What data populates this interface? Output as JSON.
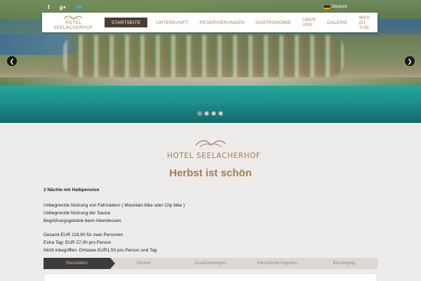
{
  "social": [
    "f",
    "g+",
    "🐦"
  ],
  "language": "Deutsch",
  "brand": {
    "line1": "HOTEL",
    "line2": "SEELACHERHOF",
    "full": "HOTEL SEELACHERHOF"
  },
  "nav": {
    "items": [
      {
        "label": "STARTSEITE",
        "active": true
      },
      {
        "label": "UNTERKUNFT",
        "active": false
      },
      {
        "label": "RESERVIERUNGEN",
        "active": false
      },
      {
        "label": "GASTRONOMIE",
        "active": false
      },
      {
        "label": "ÜBER UNS",
        "active": false
      },
      {
        "label": "GALERIE",
        "active": false
      },
      {
        "label": "WAS ZU TUN",
        "active": false
      }
    ]
  },
  "slider": {
    "prev": "❮",
    "next": "❯",
    "slide_count": 4,
    "active_slide": 1
  },
  "headline": "Herbst ist schön",
  "offer": {
    "title": "2 Nächte mit Halbpension",
    "features": [
      "Unbegrenzte Nutzung von Fahrrädern ( Mountain bike oder City bike )",
      "Unbegrenzte Nutzung der Sauna",
      "Begrüßungsgetränk beim Abendessen"
    ],
    "prices": [
      "Gesamt EUR 119,90 für zwei Personen",
      "Extra Tag: EUR 27,00 pro Person",
      "Nicht inbegriffen: Ortstaxe EUR1,50 pro Person und Tag"
    ]
  },
  "steps": [
    {
      "label": "Reisedaten",
      "active": true
    },
    {
      "label": "Zimmer",
      "active": false
    },
    {
      "label": "Zusatzleistungen",
      "active": false
    },
    {
      "label": "Persönliche Angaben",
      "active": false
    },
    {
      "label": "Bestätigung",
      "active": false
    }
  ],
  "colors": {
    "accent": "#a57d57",
    "active_nav": "#4c3b34",
    "step_active": "#3c3c3c",
    "page_bg": "#eeecea"
  }
}
